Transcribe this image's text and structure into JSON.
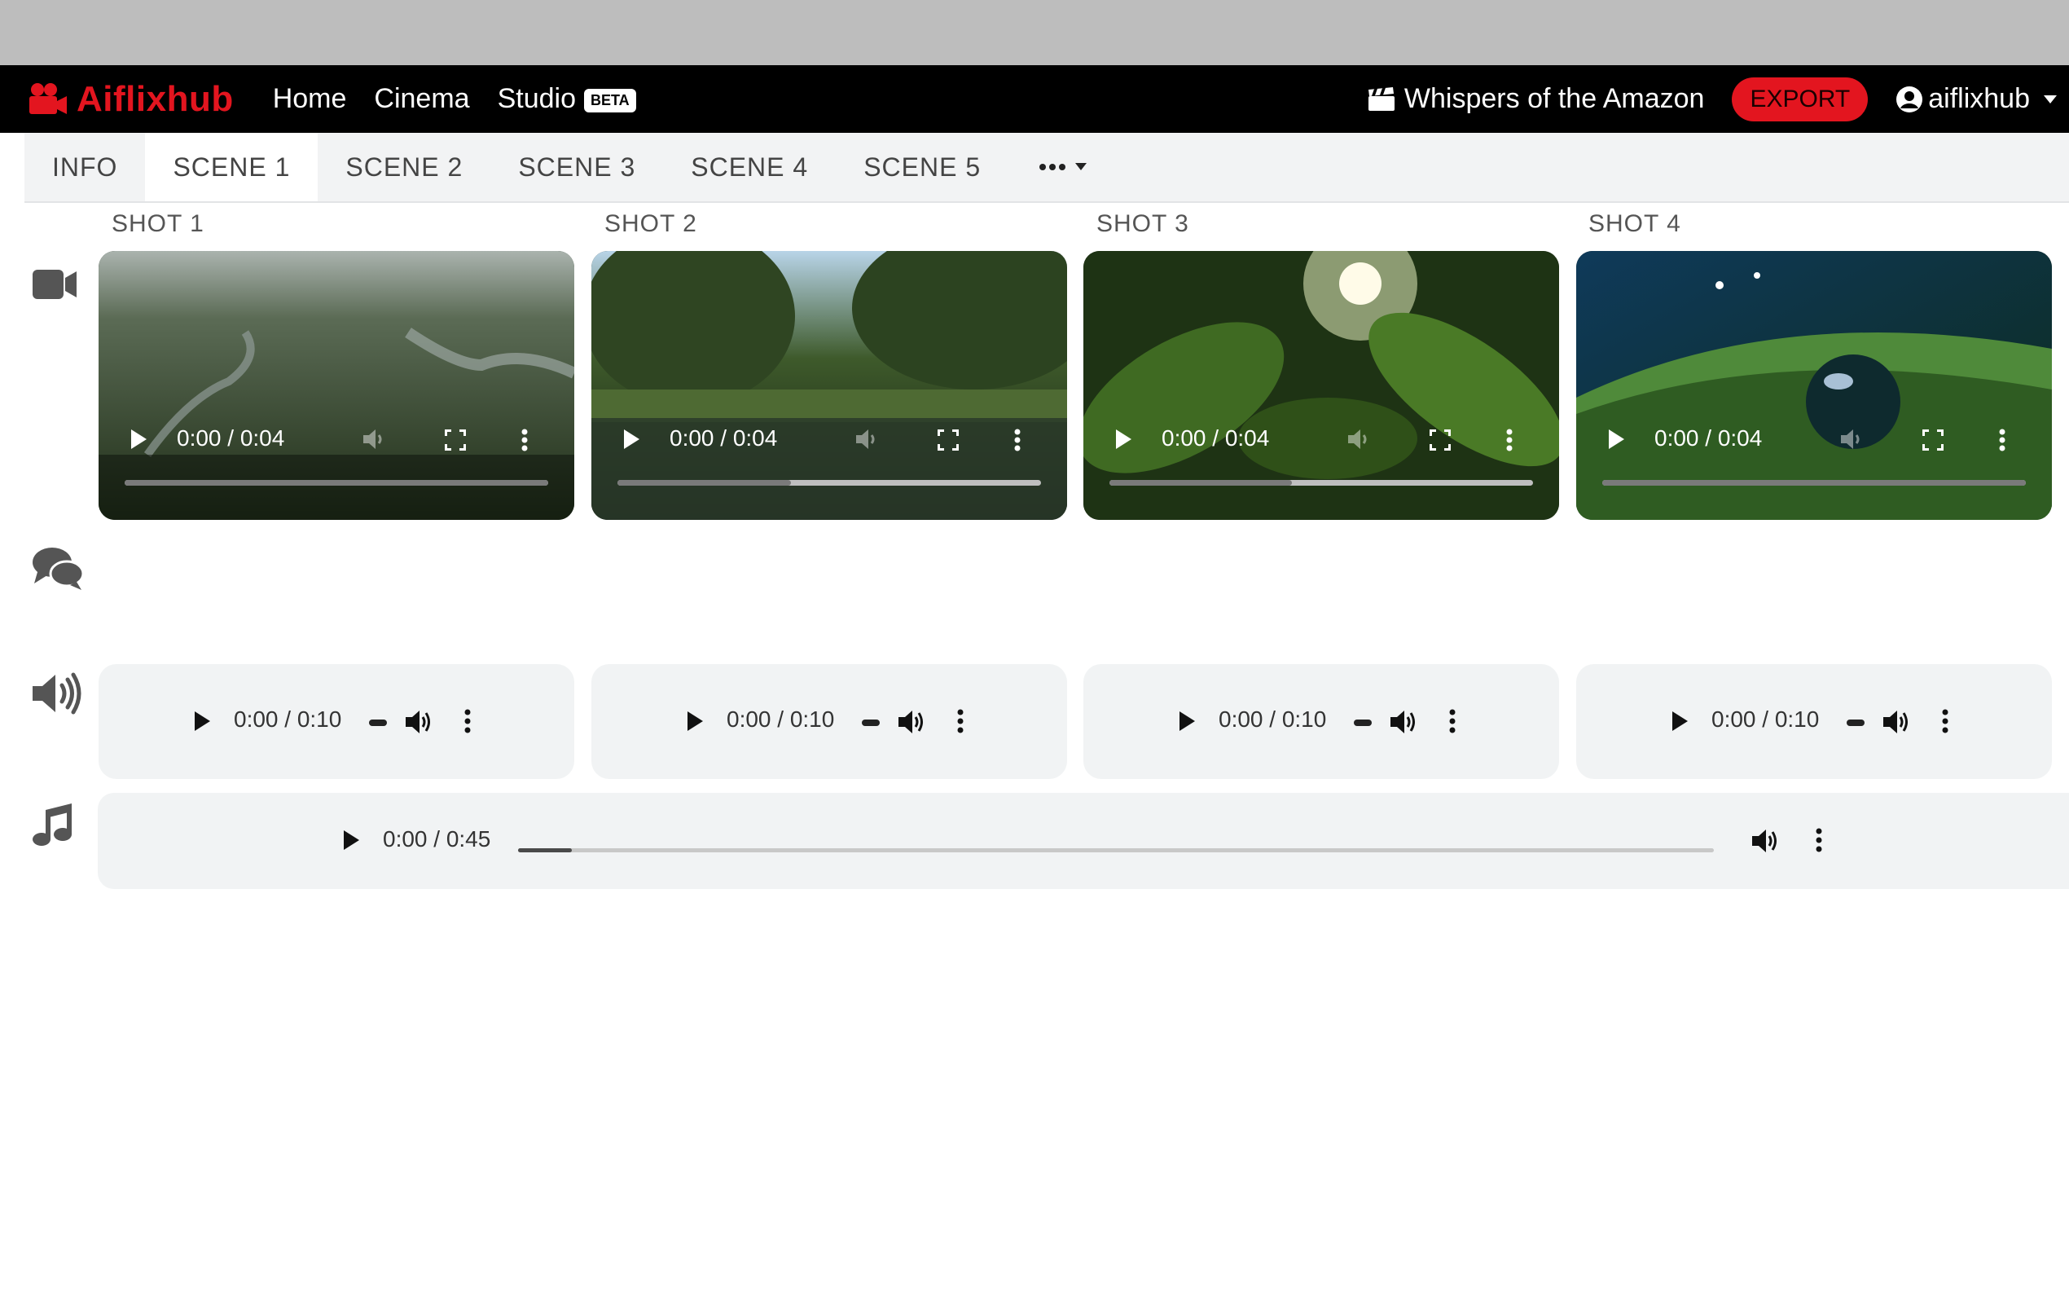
{
  "app": {
    "brand": "Aiflixhub"
  },
  "nav": {
    "home": "Home",
    "cinema": "Cinema",
    "studio": "Studio",
    "beta": "BETA"
  },
  "project": {
    "title": "Whispers of the Amazon",
    "export_label": "EXPORT"
  },
  "user": {
    "name": "aiflixhub"
  },
  "tabs": [
    {
      "label": "INFO",
      "active": false
    },
    {
      "label": "SCENE 1",
      "active": true
    },
    {
      "label": "SCENE 2",
      "active": false
    },
    {
      "label": "SCENE 3",
      "active": false
    },
    {
      "label": "SCENE 4",
      "active": false
    },
    {
      "label": "SCENE 5",
      "active": false
    }
  ],
  "shots": [
    {
      "label": "SHOT 1",
      "video_time": "0:00 / 0:04",
      "buffered": 1.0,
      "audio_time": "0:00 / 0:10"
    },
    {
      "label": "SHOT 2",
      "video_time": "0:00 / 0:04",
      "buffered": 0.41,
      "audio_time": "0:00 / 0:10"
    },
    {
      "label": "SHOT 3",
      "video_time": "0:00 / 0:04",
      "buffered": 0.43,
      "audio_time": "0:00 / 0:10"
    },
    {
      "label": "SHOT 4",
      "video_time": "0:00 / 0:04",
      "buffered": 1.0,
      "audio_time": "0:00 / 0:10"
    }
  ],
  "music": {
    "time": "0:00 / 0:45",
    "progress": 0.045
  },
  "colors": {
    "brand_red": "#e3151f",
    "navbar_bg": "#000000",
    "player_bg": "#f1f3f4"
  },
  "icons": {
    "row_video": "video-camera-icon",
    "row_dialogue": "comments-icon",
    "row_voice": "volume-icon",
    "row_music": "music-note-icon"
  }
}
